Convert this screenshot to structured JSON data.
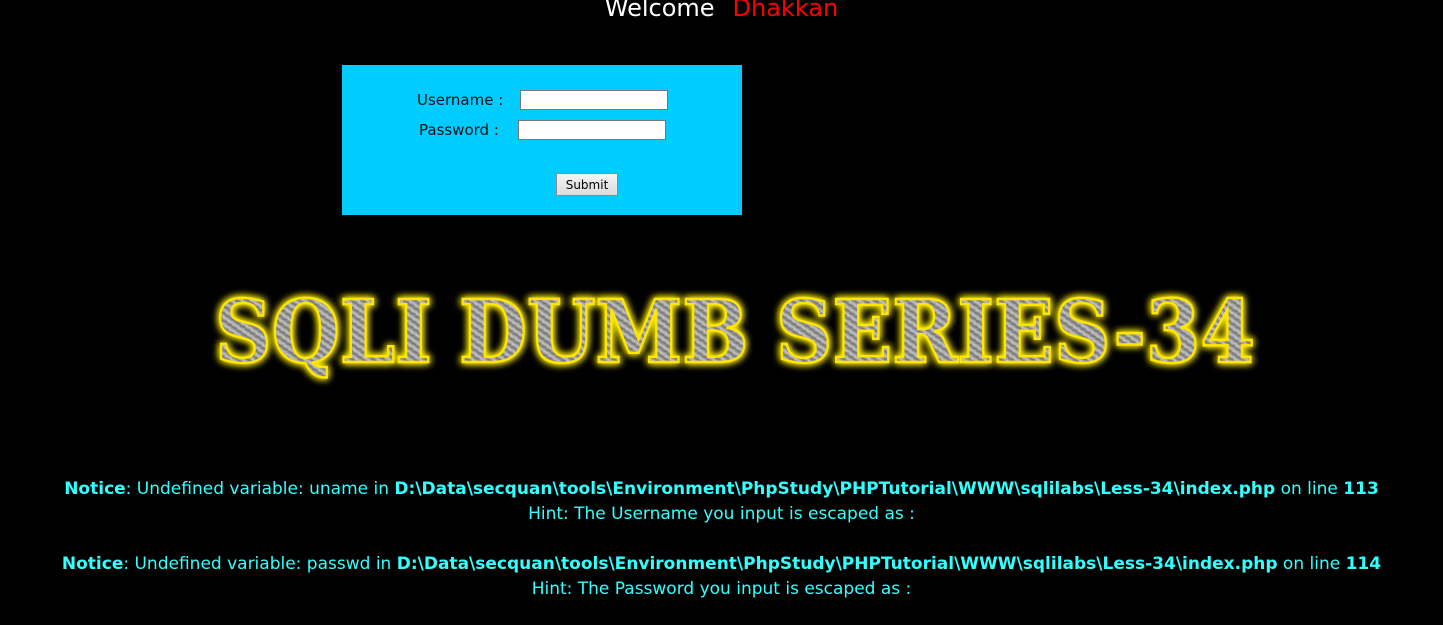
{
  "header": {
    "welcome": "Welcome",
    "user": "Dhakkan"
  },
  "login": {
    "username_label": "Username :",
    "password_label": "Password :",
    "username_value": "",
    "password_value": "",
    "submit_label": "Submit"
  },
  "banner": {
    "text": "SQLI DUMB SERIES-34"
  },
  "notices": [
    {
      "label": "Notice",
      "text_before": ": Undefined variable: uname in ",
      "path": "D:\\Data\\secquan\\tools\\Environment\\PhpStudy\\PHPTutorial\\WWW\\sqlilabs\\Less-34\\index.php",
      "text_mid": " on line ",
      "line": "113",
      "hint": "Hint: The Username you input is escaped as :"
    },
    {
      "label": "Notice",
      "text_before": ": Undefined variable: passwd in ",
      "path": "D:\\Data\\secquan\\tools\\Environment\\PhpStudy\\PHPTutorial\\WWW\\sqlilabs\\Less-34\\index.php",
      "text_mid": " on line ",
      "line": "114",
      "hint": "Hint: The Password you input is escaped as :"
    }
  ],
  "colors": {
    "background": "#000000",
    "login_box": "#00ccff",
    "welcome": "#ffffff",
    "username": "#ff0000",
    "notice_text": "#33ffff",
    "banner_glow": "#ffee00"
  }
}
